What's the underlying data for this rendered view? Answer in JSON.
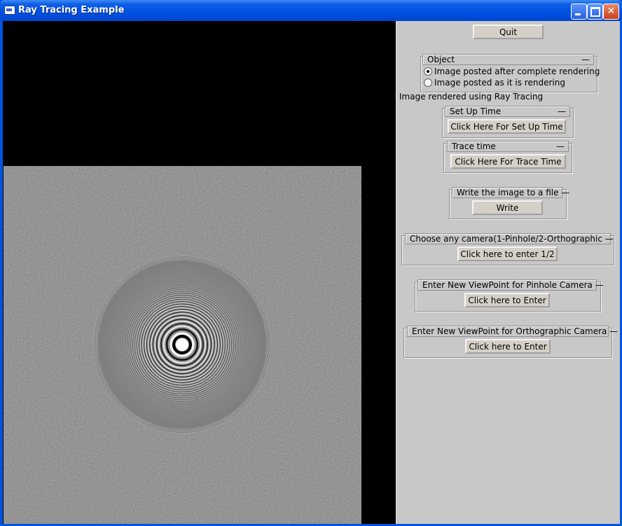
{
  "window": {
    "title": "Ray Tracing Example"
  },
  "controls": {
    "quit_label": "Quit",
    "object_group": {
      "title": "Object",
      "collapse": "—",
      "options": [
        {
          "label": "Image posted after complete rendering",
          "selected": true
        },
        {
          "label": "Image posted as it is rendering",
          "selected": false
        }
      ]
    },
    "status_text": "Image rendered using Ray Tracing",
    "setup_group": {
      "title": "Set Up Time",
      "collapse": "—",
      "button": "Click Here For Set Up Time"
    },
    "trace_group": {
      "title": "Trace time",
      "collapse": "—",
      "button": "Click Here For Trace Time"
    },
    "write_group": {
      "title": "Write the image to a file —",
      "button": "Write"
    },
    "camera_group": {
      "title": "Choose any camera(1-Pinhole/2-Orthographic —",
      "button": "Click here to enter 1/2"
    },
    "pinhole_group": {
      "title": "Enter New ViewPoint for Pinhole Camera —",
      "button": "Click here to Enter"
    },
    "ortho_group": {
      "title": "Enter New ViewPoint for Orthographic Camera —",
      "button": "Click here to Enter"
    }
  }
}
